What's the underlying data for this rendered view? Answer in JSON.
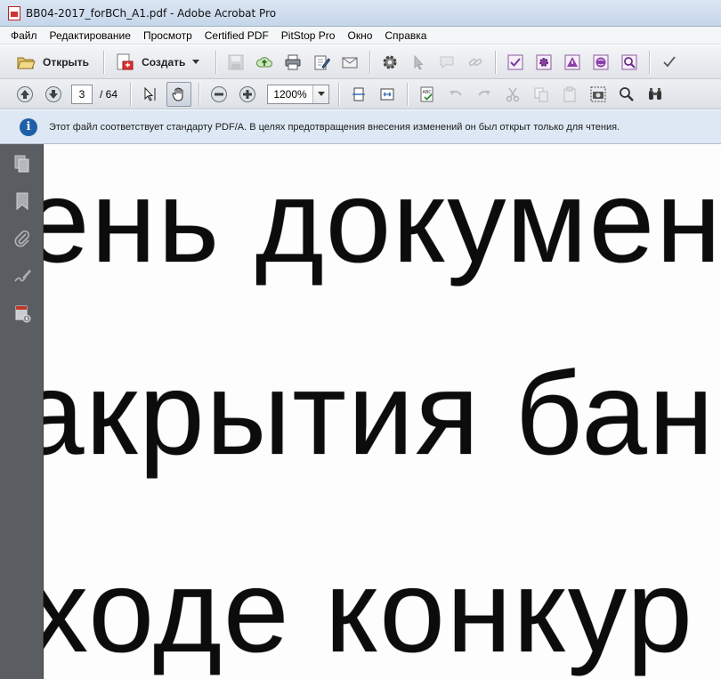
{
  "window": {
    "title": "BB04-2017_forBCh_A1.pdf - Adobe Acrobat Pro"
  },
  "menu": [
    "Файл",
    "Редактирование",
    "Просмотр",
    "Certified PDF",
    "PitStop Pro",
    "Окно",
    "Справка"
  ],
  "toolbar": {
    "open_label": "Открыть",
    "create_label": "Создать"
  },
  "navigation": {
    "current_page": "3",
    "total_pages": "/ 64",
    "zoom": "1200%"
  },
  "info_bar": {
    "message": "Этот файл соответствует стандарту PDF/A. В целях предотвращения внесения изменений он был открыт только для чтения."
  },
  "document": {
    "lines": [
      "ень докумен",
      "акрытия бан",
      "ходе конкур"
    ]
  },
  "colors": {
    "info_icon": "#1f5fa8",
    "nav_pane": "#5a5e63",
    "info_bg": "#dde8f4"
  }
}
